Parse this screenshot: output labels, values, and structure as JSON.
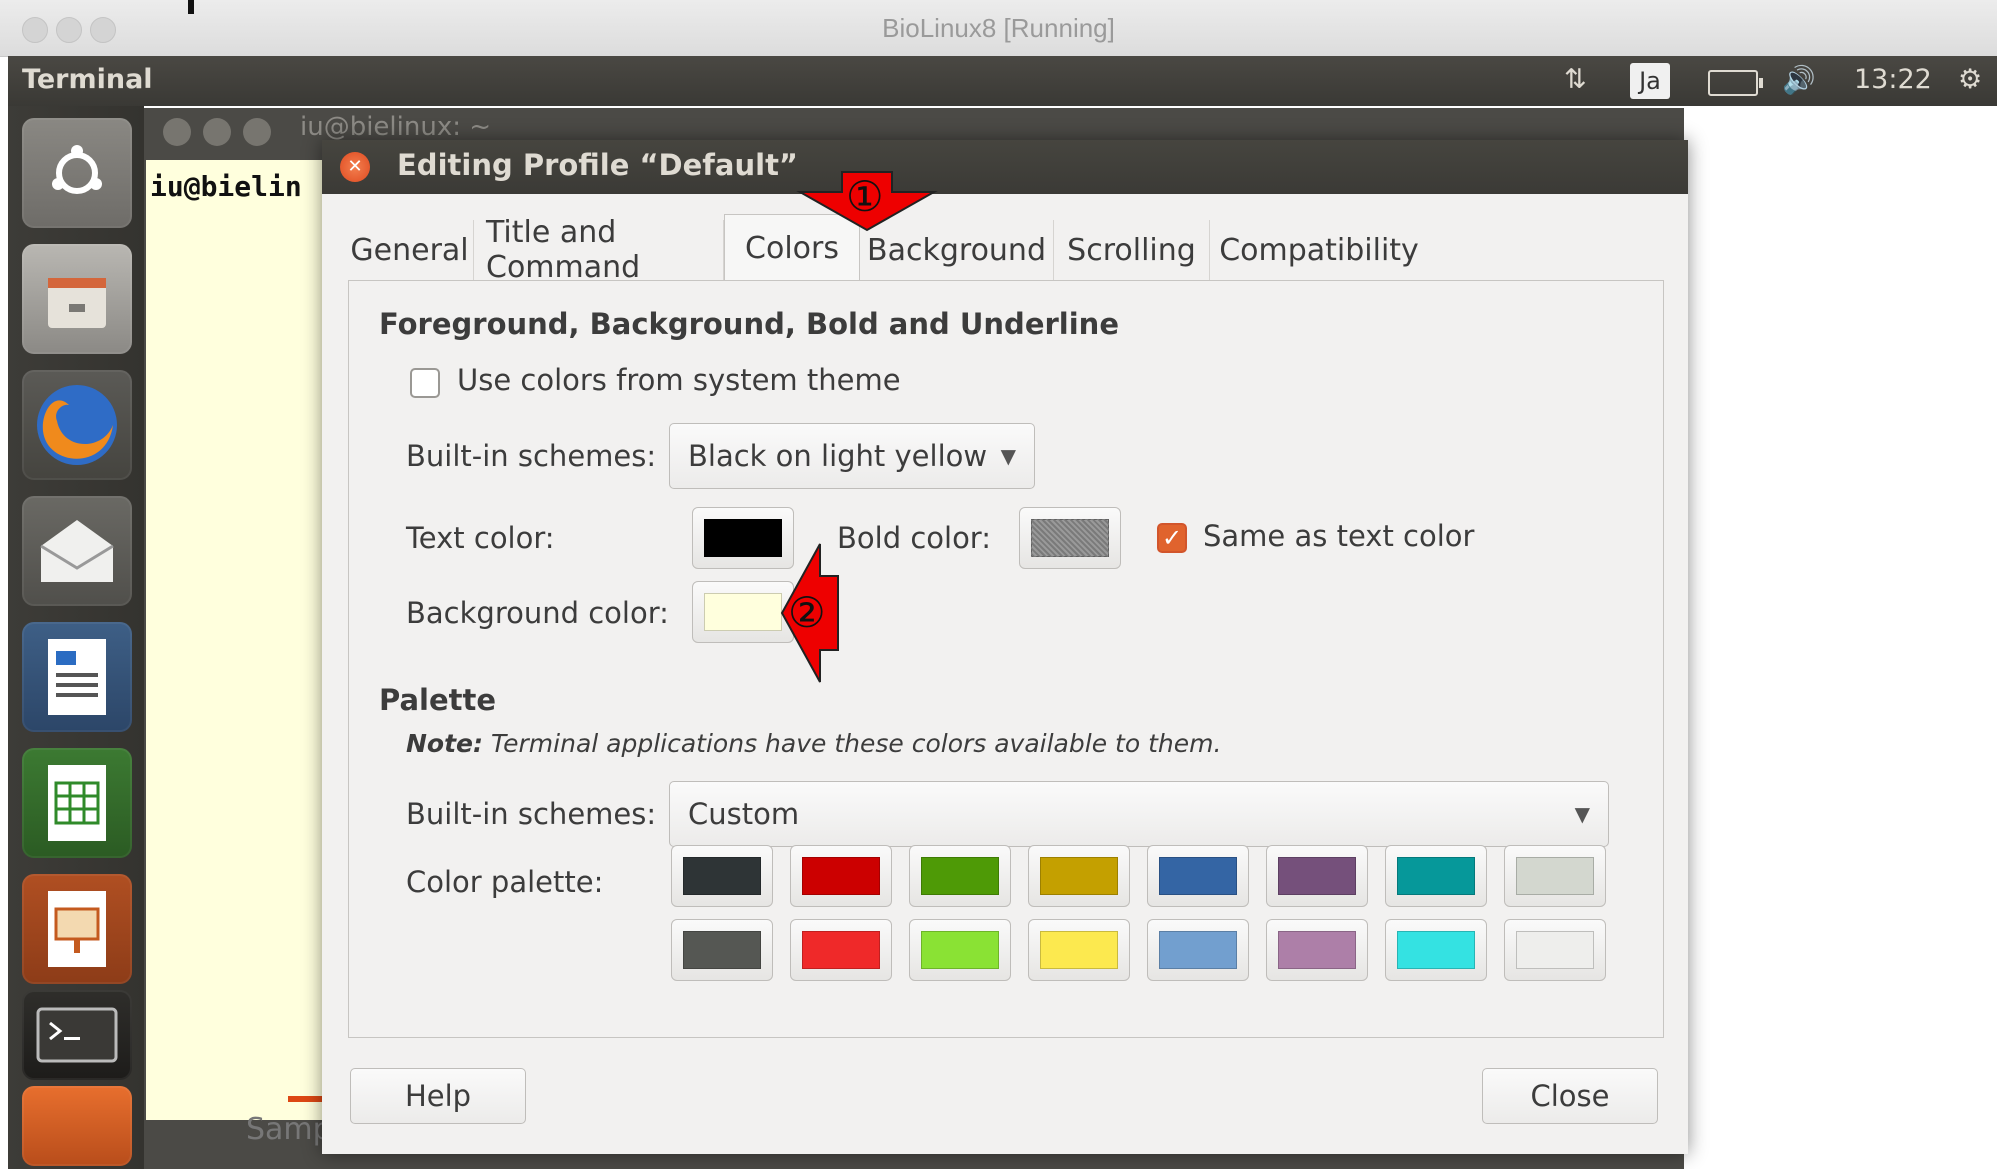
{
  "host_window": {
    "title": "BioLinux8 [Running]"
  },
  "panel": {
    "app_title": "Terminal",
    "input_method": "Ja",
    "clock": "13:22"
  },
  "terminal": {
    "title": "iu@bielinux: ~",
    "prompt": "iu@bielin",
    "desktop_label": "Samp"
  },
  "dialog": {
    "title": "Editing Profile “Default”",
    "tabs": [
      "General",
      "Title and Command",
      "Colors",
      "Background",
      "Scrolling",
      "Compatibility"
    ],
    "active_tab": "Colors",
    "fg_section": {
      "title": "Foreground, Background, Bold and Underline",
      "use_system_theme_label": "Use colors from system theme",
      "use_system_theme_checked": false,
      "schemes_label": "Built-in schemes:",
      "schemes_value": "Black on light yellow",
      "text_color_label": "Text color:",
      "text_color": "#000000",
      "bold_color_label": "Bold color:",
      "bold_color": "#7a7a7a",
      "same_as_text_label": "Same as text color",
      "same_as_text_checked": true,
      "bg_color_label": "Background color:",
      "bg_color": "#ffffdd"
    },
    "palette_section": {
      "title": "Palette",
      "note_bold": "Note:",
      "note_text": " Terminal applications have these colors available to them.",
      "schemes_label": "Built-in schemes:",
      "schemes_value": "Custom",
      "palette_label": "Color palette:",
      "row1": [
        "#2e3436",
        "#cc0000",
        "#4e9a06",
        "#c4a000",
        "#3465a4",
        "#75507b",
        "#06989a",
        "#d3d7cf"
      ],
      "row2": [
        "#555753",
        "#ef2929",
        "#8ae234",
        "#fce94f",
        "#729fcf",
        "#ad7fa8",
        "#34e2e2",
        "#eeeeec"
      ]
    },
    "help_button": "Help",
    "close_button": "Close"
  },
  "annotations": {
    "marker1": "①",
    "marker2": "②",
    "color": "#ee0000"
  }
}
